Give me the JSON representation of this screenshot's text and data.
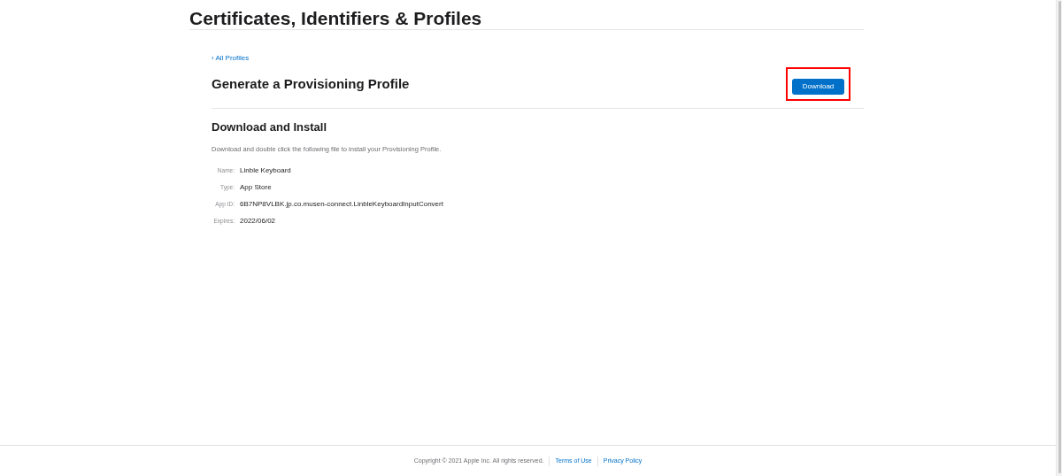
{
  "header": {
    "title": "Certificates, Identifiers & Profiles"
  },
  "back_link": "‹ All Profiles",
  "page_title": "Generate a Provisioning Profile",
  "download_button": {
    "label": "Download",
    "highlighted": true
  },
  "section": {
    "title": "Download and Install",
    "description": "Download and double click the following file to install your Provisioning Profile.",
    "details": [
      {
        "label": "Name:",
        "value": "Linble Keyboard"
      },
      {
        "label": "Type:",
        "value": "App Store"
      },
      {
        "label": "App ID:",
        "value": "6B7NP8VLBK.jp.co.musen-connect.LinbleKeyboardInputConvert"
      },
      {
        "label": "Expires:",
        "value": "2022/06/02"
      }
    ]
  },
  "footer": {
    "copyright": "Copyright © 2021 Apple Inc. All rights reserved.",
    "links": [
      "Terms of Use",
      "Privacy Policy"
    ]
  }
}
